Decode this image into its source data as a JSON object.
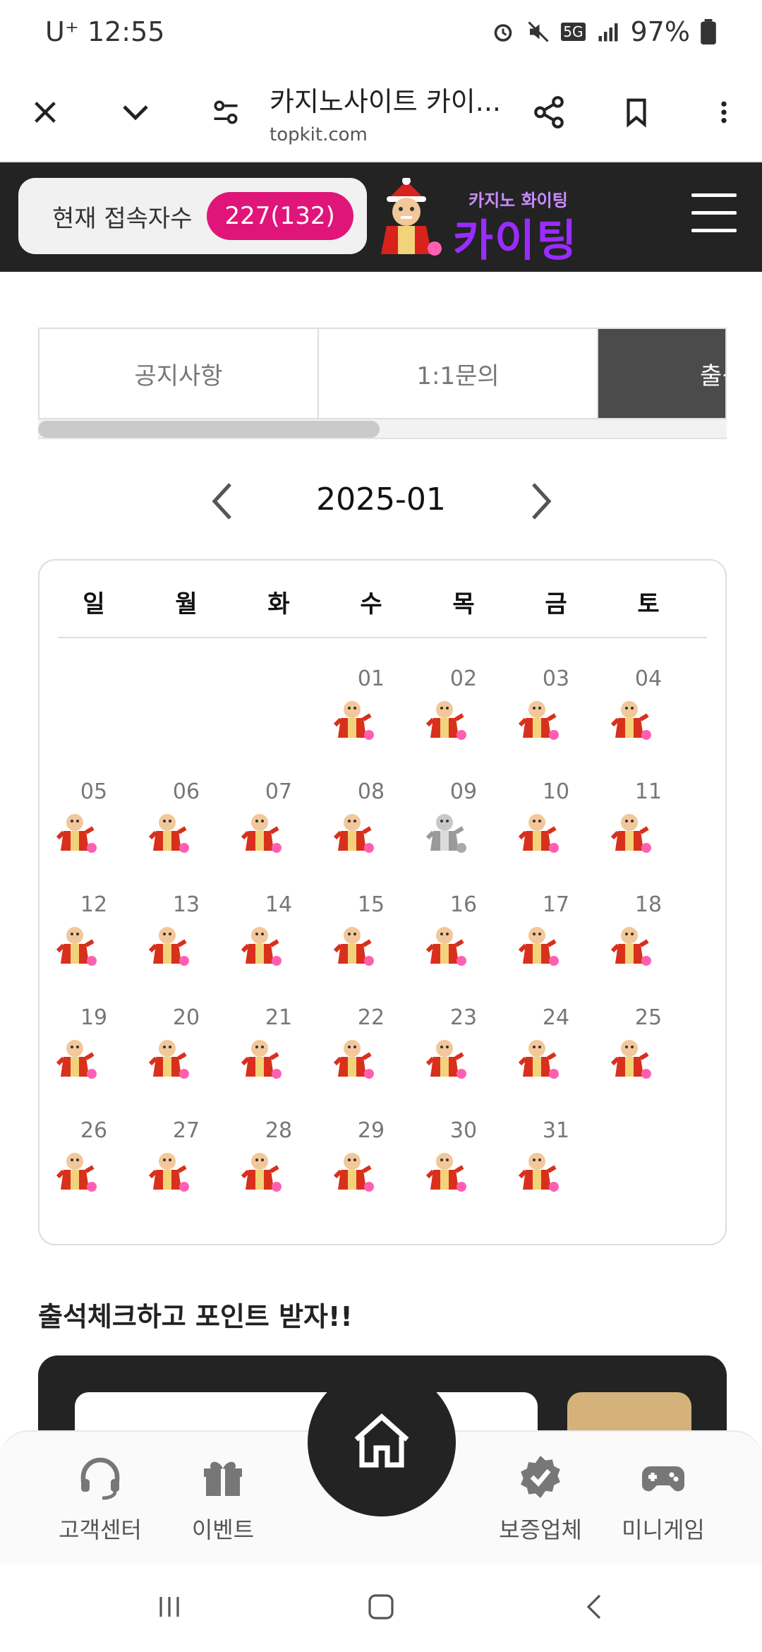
{
  "status_bar": {
    "carrier_time": "U⁺ 12:55",
    "network": "5G",
    "battery": "97%"
  },
  "browser": {
    "title": "카지노사이트 카이...",
    "url": "topkit.com"
  },
  "site_header": {
    "visitor_label": "현재 접속자수",
    "visitor_count": "227(132)",
    "logo_small": "카지노 화이팅",
    "logo_big": "카이팅"
  },
  "tabs": [
    {
      "label": "공지사항"
    },
    {
      "label": "1:1문의"
    },
    {
      "label": "출석"
    }
  ],
  "calendar": {
    "month": "2025-01",
    "weekdays": [
      "일",
      "월",
      "화",
      "수",
      "목",
      "금",
      "토"
    ],
    "days": [
      "01",
      "02",
      "03",
      "04",
      "05",
      "06",
      "07",
      "08",
      "09",
      "10",
      "11",
      "12",
      "13",
      "14",
      "15",
      "16",
      "17",
      "18",
      "19",
      "20",
      "21",
      "22",
      "23",
      "24",
      "25",
      "26",
      "27",
      "28",
      "29",
      "30",
      "31"
    ]
  },
  "points_title": "출석체크하고 포인트 받자!!",
  "bottom_nav": {
    "support": "고객센터",
    "event": "이벤트",
    "verified": "보증업체",
    "minigame": "미니게임"
  },
  "colors": {
    "accent_pink": "#e0157a",
    "dark_bg": "#232323",
    "logo_purple": "#9a2cff",
    "gold": "#d4b27a"
  }
}
